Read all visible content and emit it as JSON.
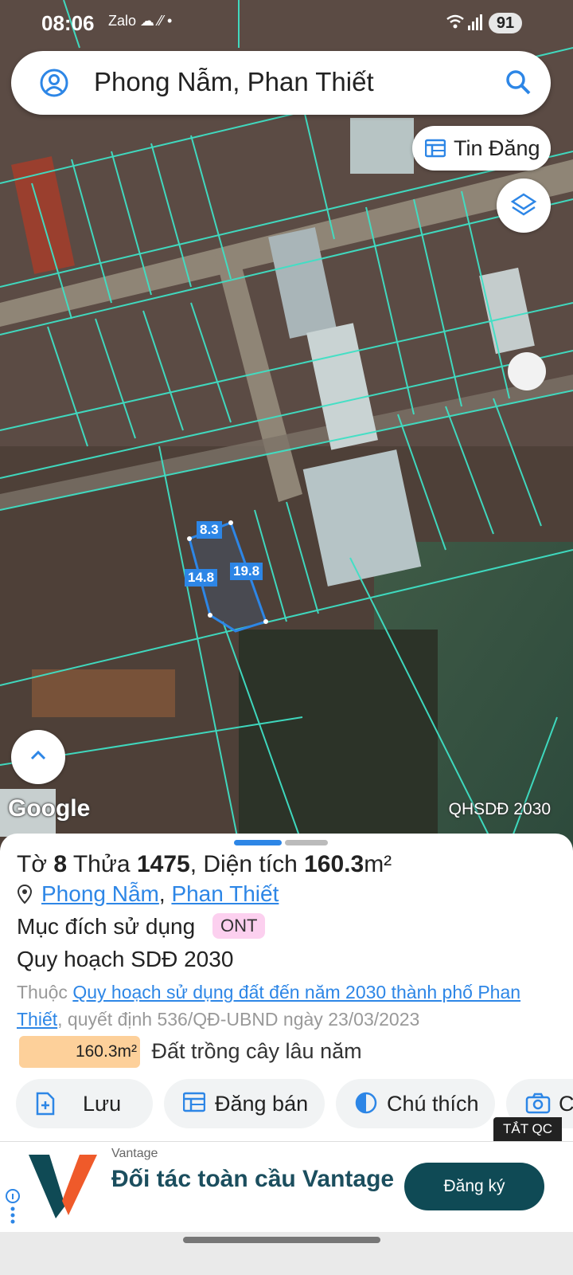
{
  "status_bar": {
    "time": "08:06",
    "app_icons": "Zalo ☁ ⁄⁄ •",
    "battery": "91"
  },
  "search": {
    "query": "Phong Nẫm, Phan Thiết"
  },
  "map": {
    "tin_dang_label": "Tin Đăng",
    "google_logo": "Google",
    "layer_label": "QHSDĐ 2030",
    "dimensions": {
      "top": "8.3",
      "left": "14.8",
      "right": "19.8"
    },
    "colors": {
      "parcel_lines": "#3fe0c5",
      "selected_parcel": "#2d86e6"
    }
  },
  "parcel": {
    "sheet_prefix": "Tờ",
    "sheet_number": "8",
    "lot_prefix": "Thửa",
    "lot_number": "1475",
    "area_prefix": ", Diện tích",
    "area_value": "160.3",
    "area_unit": "m²",
    "ward": "Phong Nẫm",
    "city": "Phan Thiết",
    "purpose_label": "Mục đích sử dụng",
    "purpose_code": "ONT",
    "plan_title": "Quy hoạch SDĐ 2030",
    "desc_prefix": "Thuộc",
    "desc_link": "Quy hoạch sử dụng đất đến năm 2030 thành phố Phan Thiết",
    "desc_suffix": ", quyết định 536/QĐ-UBND ngày 23/03/2023",
    "area_chip": "160.3m²",
    "land_type": "Đất trồng cây lâu năm"
  },
  "actions": {
    "save": "Lưu",
    "post_sale": "Đăng bán",
    "legend": "Chú thích",
    "camera_partial": "C"
  },
  "ad": {
    "tat_qc": "TẮT QC",
    "brand": "Vantage",
    "headline": "Đối tác toàn cầu Vantage",
    "cta": "Đăng ký"
  }
}
